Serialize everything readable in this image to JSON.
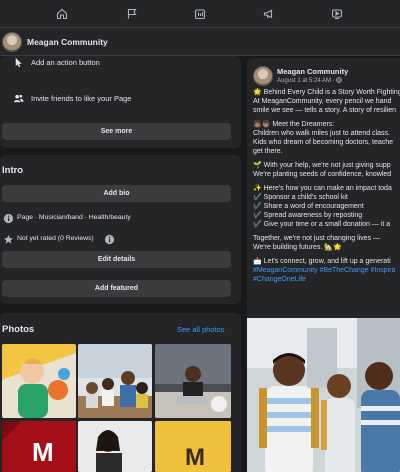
{
  "page": {
    "name": "Meagan Community"
  },
  "top_nav": {
    "icons": [
      "home-icon",
      "flag-icon",
      "video-feed-icon",
      "megaphone-icon",
      "watch-icon"
    ]
  },
  "actions": {
    "add_action_button": "Add an action button",
    "invite_friends": "Invite friends to like your Page",
    "see_more": "See more"
  },
  "intro": {
    "title": "Intro",
    "add_bio": "Add bio",
    "category_line": "Page · Musician/band · Health/beauty",
    "rating": "Not yet rated (0 Reviews)",
    "edit_details": "Edit details",
    "add_featured": "Add featured"
  },
  "photos": {
    "title": "Photos",
    "see_all": "See all photos"
  },
  "post": {
    "author": "Meagan Community",
    "time": "August 1 at 5:24 AM · ",
    "lines": [
      "🌟 Behind Every Child is a Story Worth Fighting",
      "At MeaganCommunity, every pencil we hand",
      "smile we see — tells a story. A story of resilien",
      "",
      "👧🏽👦🏽 Meet the Dreamers:",
      "Children who walk miles just to attend class.",
      "Kids who dream of becoming doctors, teache",
      "get there.",
      "",
      "🌱 With your help, we're not just giving supp",
      "We're planting seeds of confidence, knowled",
      "",
      "✨ Here's how you can make an impact toda",
      "✔️ Sponsor a child's school kit",
      "✔️ Share a word of encouragement",
      "✔️ Spread awareness by reposting",
      "✔️ Give your time or a small donation — it a",
      "",
      "Together, we're not just changing lives —",
      "We're building futures. 🏡🌟",
      "",
      "📩 Let's connect, grow, and lift up a generati"
    ],
    "hashtags": [
      "#MeaganCommunity #BeTheChange #Inspira",
      "#ChangeOneLife"
    ]
  },
  "colors": {
    "background": "#18191a",
    "card": "#242526",
    "button": "#3a3b3c",
    "link": "#4599ff",
    "text": "#e4e6eb",
    "muted": "#b0b3b8"
  }
}
